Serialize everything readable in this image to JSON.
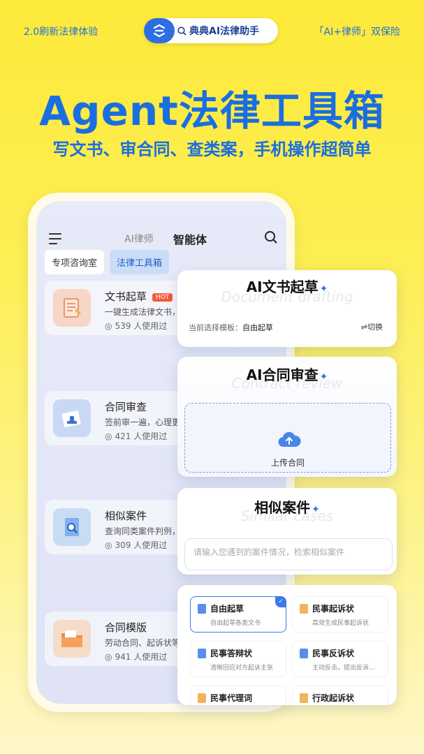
{
  "top": {
    "left_text": "2.0刷新法律体验",
    "right_text": "「AI+律师」双保险",
    "pill_text": "典典AI法律助手"
  },
  "hero": {
    "headline": "Agent法律工具箱",
    "subline": "写文书、审合同、查类案，手机操作超简单"
  },
  "app": {
    "nav": {
      "tab_ai": "AI律师",
      "tab_agent": "智能体"
    },
    "chips": [
      "专项咨询室",
      "法律工具箱"
    ],
    "cards": [
      {
        "title": "文书起草",
        "badge": "HOT",
        "desc": "一键生成法律文书，",
        "usage": "539 人使用过",
        "color": "#f6d6c7"
      },
      {
        "title": "合同审查",
        "desc": "签前审一遍，心理更",
        "usage": "421 人使用过",
        "color": "#c9d9f5"
      },
      {
        "title": "相似案件",
        "desc": "查询同类案件判例，",
        "usage": "309 人使用过",
        "color": "#c8dcf4"
      },
      {
        "title": "合同模版",
        "desc": "劳动合同、起诉状等",
        "usage": "941 人使用过",
        "color": "#f5dcc9"
      }
    ]
  },
  "panels": {
    "draft": {
      "title": "AI文书起草",
      "watermark": "Document drafting",
      "template_label": "当前选择模板：",
      "template_value": "自由起草",
      "switch": "⇌切换"
    },
    "review": {
      "title": "AI合同审查",
      "watermark": "Contract review",
      "upload": "上传合同"
    },
    "similar": {
      "title": "相似案件",
      "watermark": "Similar cases",
      "placeholder": "请输入您遇到的案件情况，检索相似案件"
    },
    "templates": [
      {
        "title": "自由起草",
        "desc": "自由起草各类文书",
        "selected": true,
        "icon_color": "#5a8de8"
      },
      {
        "title": "民事起诉状",
        "desc": "高效生成民事起诉状",
        "icon_color": "#f0b45c"
      },
      {
        "title": "民事答辩状",
        "desc": "清晰回应对方起诉主张",
        "icon_color": "#5a8de8"
      },
      {
        "title": "民事反诉状",
        "desc": "主动反击，提出反诉…",
        "icon_color": "#5a8de8"
      },
      {
        "title": "民事代理词",
        "desc": "",
        "icon_color": "#f0b45c"
      },
      {
        "title": "行政起诉状",
        "desc": "",
        "icon_color": "#f0b45c"
      }
    ]
  }
}
